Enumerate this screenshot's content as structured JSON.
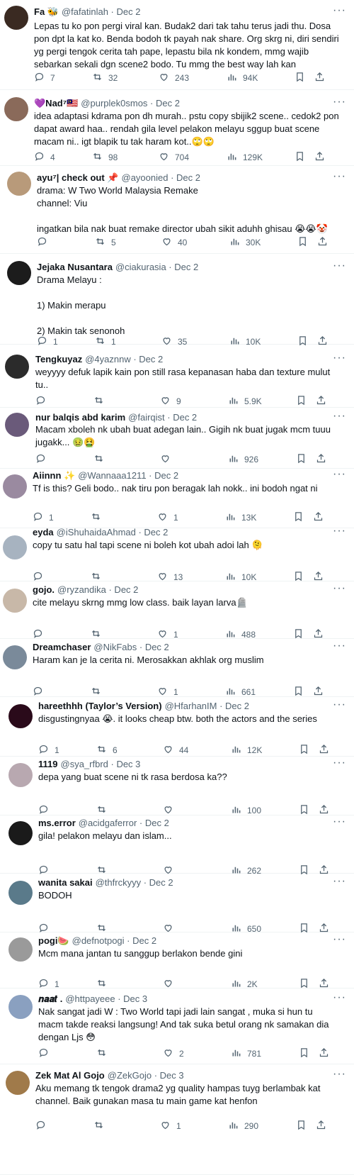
{
  "colors": {
    "text": "#0f1419",
    "secondary": "#536471",
    "divider": "#eff3f4"
  },
  "icons": {
    "reply": "speech-bubble-icon",
    "retweet": "retweet-arrows-icon",
    "like": "heart-icon",
    "views": "bar-chart-icon",
    "bookmark": "bookmark-icon",
    "share": "share-upload-icon",
    "more": "more-dots-icon"
  },
  "tweets": [
    {
      "name": "Fa 🐝",
      "handle": "@fafatinlah · Dec 2",
      "text": "Lepas tu ko pon pergi viral kan. Budak2 dari tak tahu terus jadi thu. Dosa pon dpt la kat ko. Benda bodoh tk payah nak share. Org skrg ni, diri sendiri yg pergi tengok cerita tah pape, lepastu bila nk kondem, mmg wajib sebarkan sekali dgn scene2 bodo. Tu mmg the best way lah kan",
      "replies": "7",
      "retweets": "32",
      "likes": "243",
      "views": "94K",
      "avatar_color": "#3a2a22"
    },
    {
      "name": "💜Nad⁷🇲🇾",
      "handle": "@purplek0smos · Dec 2",
      "text": "idea adaptasi kdrama pon dh murah.. pstu copy sbijik2 scene.. cedok2 pon dapat award haa.. rendah gila level pelakon melayu sggup buat scene macam ni.. igt blapik tu tak haram kot..🙄🙄",
      "replies": "4",
      "retweets": "98",
      "likes": "704",
      "views": "129K",
      "avatar_color": "#8a6a5a"
    },
    {
      "name": "ayu⁷| check out 📌",
      "handle": "@ayoonied · Dec 2",
      "text": "drama: W Two World Malaysia Remake\nchannel: Viu\n\ningatkan bila nak buat remake director ubah sikit aduhh ghisau 😭😭🤡",
      "replies": "",
      "retweets": "5",
      "likes": "40",
      "views": "30K",
      "avatar_color": "#b89a7a"
    },
    {
      "name": "Jejaka Nusantara",
      "handle": "@ciakurasia · Dec 2",
      "text": "Drama Melayu :\n\n1) Makin merapu\n\n2) Makin tak senonoh",
      "replies": "1",
      "retweets": "1",
      "likes": "35",
      "views": "10K",
      "avatar_color": "#1c1c1c"
    },
    {
      "name": "Tengkuyaz",
      "handle": "@4yaznnw · Dec 2",
      "text": "weyyyy defuk lapik kain pon still rasa kepanasan haba dan texture mulut tu..",
      "replies": "",
      "retweets": "",
      "likes": "9",
      "views": "5.9K",
      "avatar_color": "#2b2b2b"
    },
    {
      "name": "nur balqis abd karim",
      "handle": "@fairqist · Dec 2",
      "text": "Macam xboleh nk ubah buat adegan lain..  Gigih nk buat jugak mcm tuuu jugakk... 🤢🤮",
      "replies": "",
      "retweets": "",
      "likes": "",
      "views": "926",
      "avatar_color": "#6a5a7a"
    },
    {
      "name": "Aiinnn ✨",
      "handle": "@Wannaaa1211 · Dec 2",
      "text": "Tf is this? Geli bodo.. nak tiru pon beragak lah nokk.. ini bodoh ngat ni",
      "replies": "1",
      "retweets": "",
      "likes": "1",
      "views": "13K",
      "avatar_color": "#9a8aa0"
    },
    {
      "name": "eyda",
      "handle": "@iShuhaidaAhmad · Dec 2",
      "text": "copy tu satu hal tapi scene ni boleh kot ubah adoi lah 🫠",
      "replies": "",
      "retweets": "",
      "likes": "13",
      "views": "10K",
      "avatar_color": "#a7b3c0"
    },
    {
      "name": "gojo.",
      "handle": "@ryzandika · Dec 2",
      "text": "cite melayu skrng mmg low class. baik layan larva🪦",
      "replies": "",
      "retweets": "",
      "likes": "1",
      "views": "488",
      "avatar_color": "#c8b8a8"
    },
    {
      "name": "Dreamchaser",
      "handle": "@NikFabs · Dec 2",
      "text": "Haram kan je la cerita ni. Merosakkan akhlak org muslim",
      "replies": "",
      "retweets": "",
      "likes": "1",
      "views": "661",
      "avatar_color": "#7a8a9a"
    },
    {
      "name": "hareethhh (Taylor’s Version)",
      "handle": "@HfarhanIM · Dec 2",
      "text": "disgustingnyaa 😭. it looks cheap btw. both the actors and the series",
      "replies": "1",
      "retweets": "6",
      "likes": "44",
      "views": "12K",
      "avatar_color": "#2a0a1a"
    },
    {
      "name": "1119",
      "handle": "@sya_rfbrd · Dec 3",
      "text": "depa yang buat scene ni tk rasa berdosa ka??",
      "replies": "",
      "retweets": "",
      "likes": "",
      "views": "100",
      "avatar_color": "#b8a8b0"
    },
    {
      "name": "ms.error",
      "handle": "@acidgaferror · Dec 2",
      "text": "gila! pelakon melayu dan islam...",
      "replies": "",
      "retweets": "",
      "likes": "",
      "views": "262",
      "avatar_color": "#1a1a1a"
    },
    {
      "name": "wanita sakai",
      "handle": "@thfrckyyy · Dec 2",
      "text": "BODOH",
      "replies": "",
      "retweets": "",
      "likes": "",
      "views": "650",
      "avatar_color": "#5a7a8a"
    },
    {
      "name": "pogi🍉",
      "handle": "@defnotpogi · Dec 2",
      "text": "Mcm mana jantan tu sanggup berlakon bende gini",
      "replies": "1",
      "retweets": "",
      "likes": "",
      "views": "2K",
      "avatar_color": "#9a9a9a"
    },
    {
      "name": "𝒏𝒂𝒂𝒕 .",
      "handle": "@httpayeee · Dec 3",
      "text": "Nak sangat jadi W : Two World tapi jadi lain sangat , muka si hun tu macm takde reaksi langsung! And tak suka betul orang nk samakan dia dengan Ljs 😳",
      "replies": "",
      "retweets": "",
      "likes": "2",
      "views": "781",
      "avatar_color": "#8aa0c0"
    },
    {
      "name": "Zek Mat Al Gojo",
      "handle": "@ZekGojo · Dec 3",
      "text": "Aku memang tk tengok drama2 yg quality hampas tuyg berlambak kat channel. Baik gunakan masa tu main game kat henfon",
      "replies": "",
      "retweets": "",
      "likes": "1",
      "views": "290",
      "avatar_color": "#a07a4a"
    }
  ]
}
